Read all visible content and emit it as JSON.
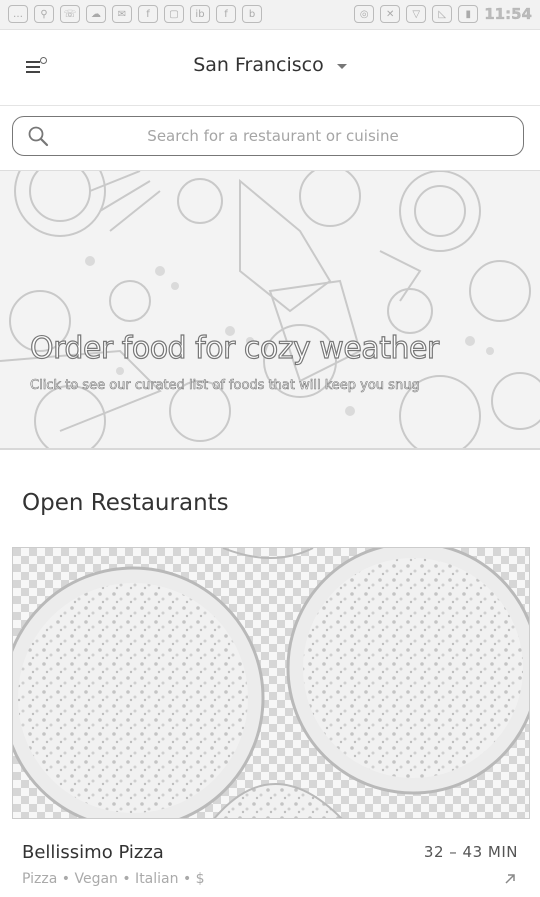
{
  "status_bar": {
    "time": "11:54",
    "left_icons": [
      "chat-icon",
      "search-icon",
      "phone-icon",
      "cloud-icon",
      "message-icon",
      "facebook-icon",
      "clipboard-icon",
      "ib-icon",
      "facebook-icon",
      "b-icon"
    ],
    "right_icons": [
      "vibrate-icon",
      "no-sim-icon",
      "wifi-icon",
      "signal-icon",
      "battery-icon"
    ]
  },
  "app_bar": {
    "city": "San Francisco"
  },
  "search": {
    "placeholder": "Search for a restaurant or cuisine"
  },
  "hero": {
    "title": "Order food for cozy weather",
    "subtitle": "Click to see our curated list of foods that will keep you snug"
  },
  "sections": {
    "open_restaurants_title": "Open Restaurants"
  },
  "restaurants": [
    {
      "name": "Bellissimo Pizza",
      "delivery_time": "32 – 43 MIN",
      "tags": "Pizza • Vegan • Italian • $"
    }
  ]
}
